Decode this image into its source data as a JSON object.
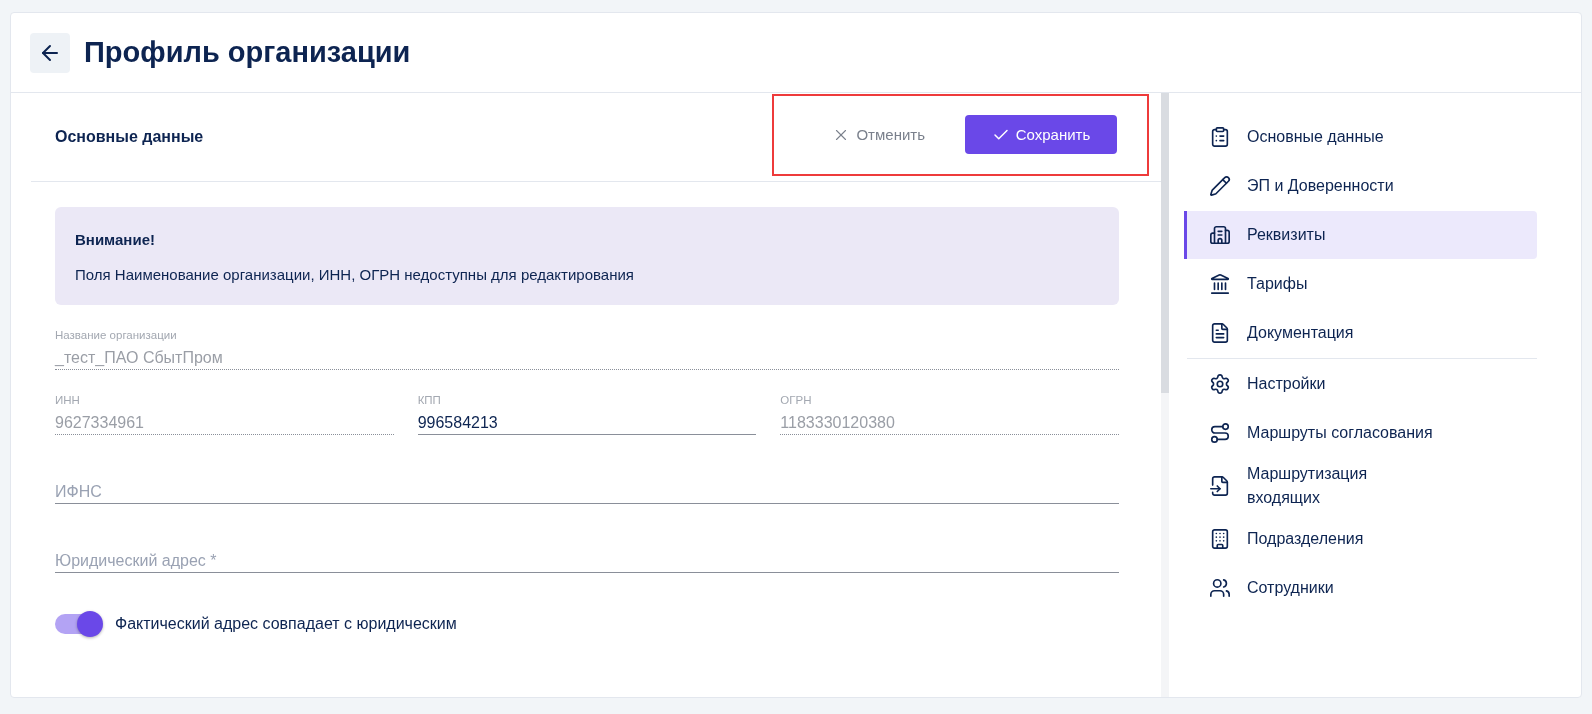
{
  "header": {
    "title": "Профиль организации"
  },
  "section": {
    "title": "Основные данные",
    "highlighted": true,
    "cancel_label": "Отменить",
    "save_label": "Сохранить"
  },
  "notice": {
    "title": "Внимание!",
    "text": "Поля Наименование организации, ИНН, ОГРН недоступны для редактирования"
  },
  "field_rows": [
    [
      {
        "label": "Название организации",
        "value": "_тест_ПАО СбытПром",
        "disabled": true
      }
    ],
    [
      {
        "label": "ИНН",
        "value": "9627334961",
        "disabled": true
      },
      {
        "label": "КПП",
        "value": "996584213",
        "disabled": false
      },
      {
        "label": "ОГРН",
        "value": "1183330120380",
        "disabled": true
      }
    ],
    [
      {
        "placeholder": "ИФНС",
        "disabled": false
      }
    ],
    [
      {
        "placeholder": "Юридический адрес *",
        "disabled": false
      }
    ]
  ],
  "toggle": {
    "label": "Фактический адрес совпадает с юридическим",
    "on": true
  },
  "sidebar": {
    "sections": [
      {
        "items": [
          {
            "label": "Основные данные",
            "selected": false
          },
          {
            "label": "ЭП и Доверенности",
            "selected": false
          },
          {
            "label": "Реквизиты",
            "selected": true
          },
          {
            "label": "Тарифы",
            "selected": false
          },
          {
            "label": "Документация",
            "selected": false
          }
        ]
      },
      {
        "items": [
          {
            "label": "Настройки",
            "selected": false
          },
          {
            "label": "Маршруты согласования",
            "selected": false
          },
          {
            "label": "Маршрутизация входящих",
            "selected": false
          },
          {
            "label": "Подразделения",
            "selected": false
          },
          {
            "label": "Сотрудники",
            "selected": false
          }
        ]
      }
    ]
  }
}
